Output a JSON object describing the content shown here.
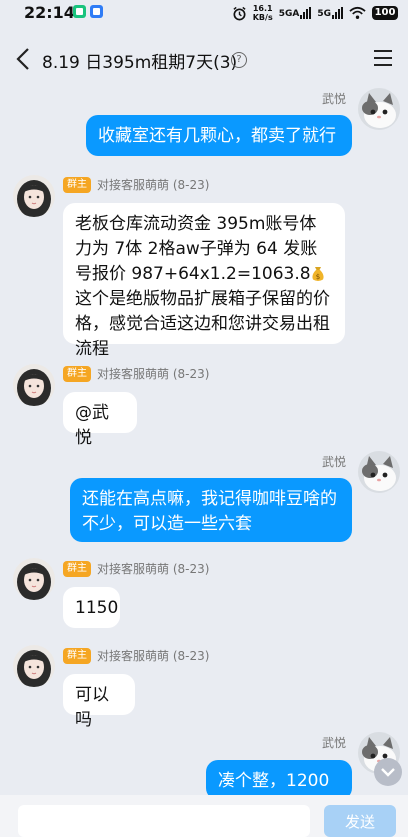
{
  "status_bar": {
    "time": "22:14",
    "net_speed": "16.1",
    "net_unit": "KB/s",
    "sig1": "5GA",
    "sig2": "5G",
    "battery": "100"
  },
  "header": {
    "title": "8.19 日395m租期7天(3)"
  },
  "messages": [
    {
      "side": "right",
      "sender": "武悦",
      "text": "收藏室还有几颗心，都卖了就行"
    },
    {
      "side": "left",
      "badge": "群主",
      "sender": "对接客服萌萌 (8-23)",
      "text_a": "老板仓库流动资金 395m账号体力为 7体 2格aw子弹为 64 发账号报价 987+64x1.2=1063.8",
      "text_b": "这个是绝版物品扩展箱子保留的价格，感觉合适这边和您讲交易出租流程"
    },
    {
      "side": "left",
      "badge": "群主",
      "sender": "对接客服萌萌 (8-23)",
      "text": "@武悦"
    },
    {
      "side": "right",
      "sender": "武悦",
      "text": "还能在高点嘛，我记得咖啡豆啥的不少，可以造一些六套"
    },
    {
      "side": "left",
      "badge": "群主",
      "sender": "对接客服萌萌 (8-23)",
      "text": "1150"
    },
    {
      "side": "left",
      "badge": "群主",
      "sender": "对接客服萌萌 (8-23)",
      "text": "可以吗"
    },
    {
      "side": "right",
      "sender": "武悦",
      "text": "凑个整，1200呗"
    }
  ],
  "input_bar": {
    "placeholder": "",
    "send_label": "发送"
  },
  "colors": {
    "outgoing_bubble": "#0a99ff",
    "incoming_bubble": "#ffffff",
    "badge": "#f5a623",
    "background": "#e9ecf2"
  },
  "icons": {
    "back": "chevron-left-icon",
    "help": "question-circle-icon",
    "menu": "hamburger-menu-icon",
    "scroll": "chevron-down-icon",
    "coin": "money-bag-icon"
  }
}
